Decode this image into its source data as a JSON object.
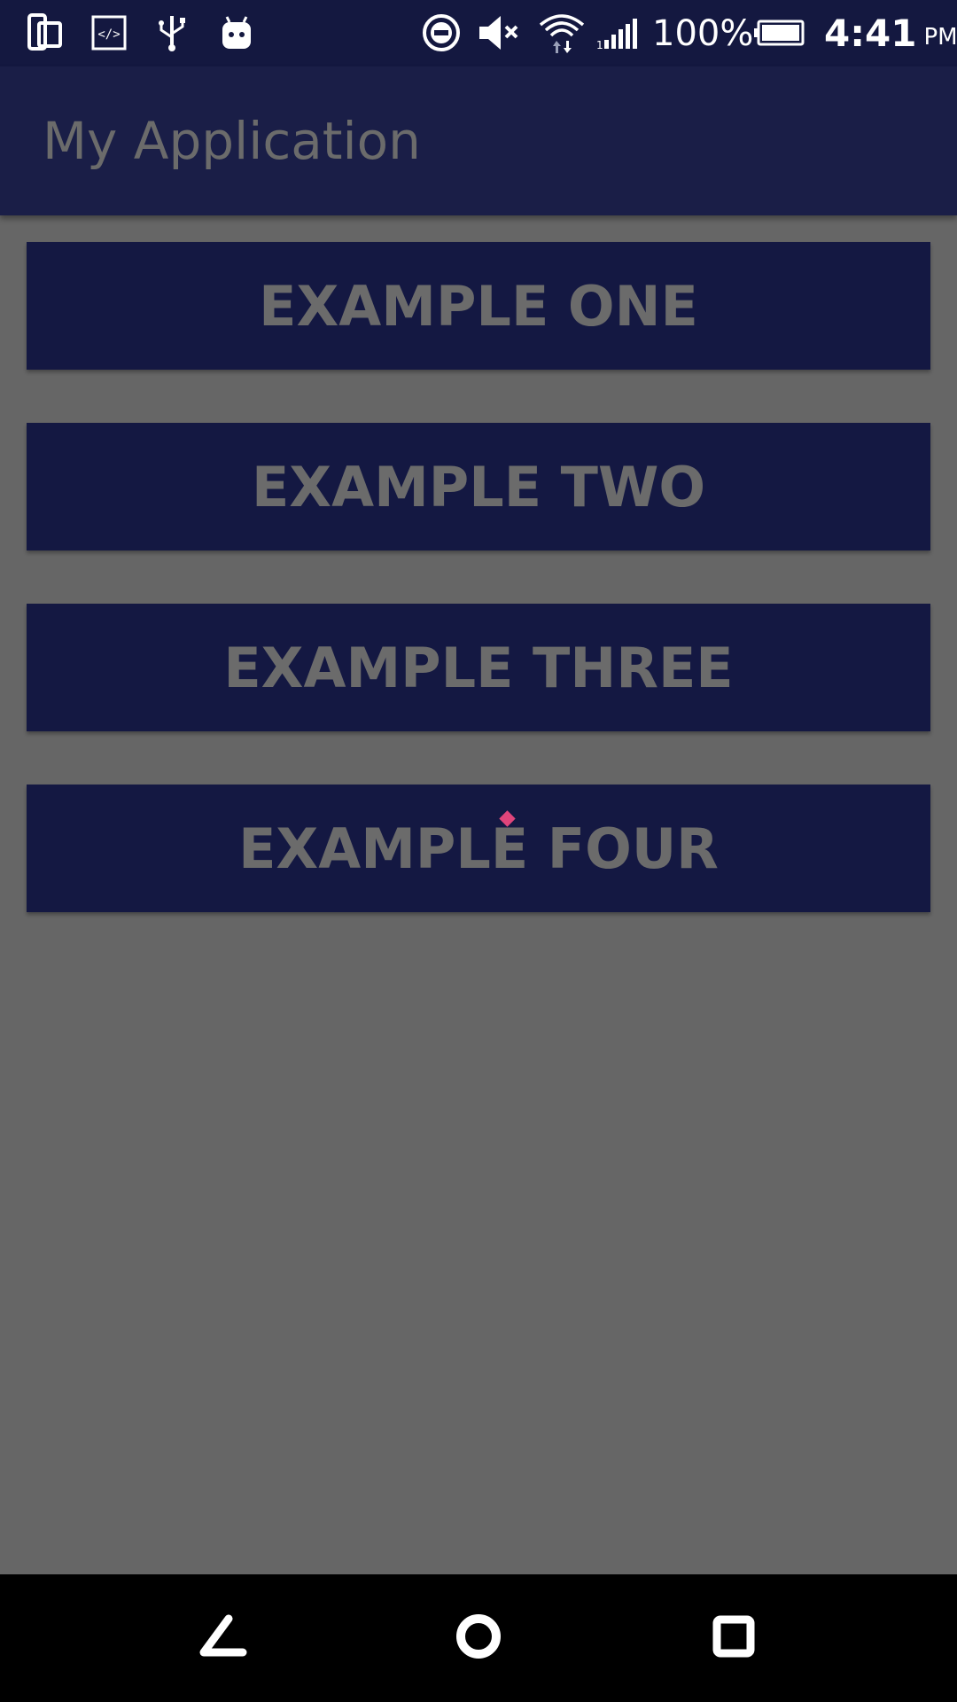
{
  "status_bar": {
    "battery_percent": "100%",
    "time": "4:41",
    "ampm": "PM",
    "icons": [
      "screen-rotate-icon",
      "code-icon",
      "usb-icon",
      "android-icon",
      "do-not-disturb-icon",
      "mute-icon",
      "wifi-icon",
      "signal-icon",
      "battery-icon"
    ]
  },
  "app_bar": {
    "title": "My Application"
  },
  "buttons": [
    {
      "label": "EXAMPLE ONE"
    },
    {
      "label": "EXAMPLE TWO"
    },
    {
      "label": "EXAMPLE THREE"
    },
    {
      "label": "EXAMPLE FOUR"
    }
  ],
  "nav_bar": {
    "icons": [
      "back-icon",
      "home-icon",
      "recents-icon"
    ]
  },
  "colors": {
    "status_bar_bg": "#141840",
    "app_bar_bg": "#1a1e47",
    "button_bg": "#141842",
    "content_bg": "#666666",
    "text_dim": "#6b6b6b",
    "touch_indicator": "#e0457b"
  }
}
